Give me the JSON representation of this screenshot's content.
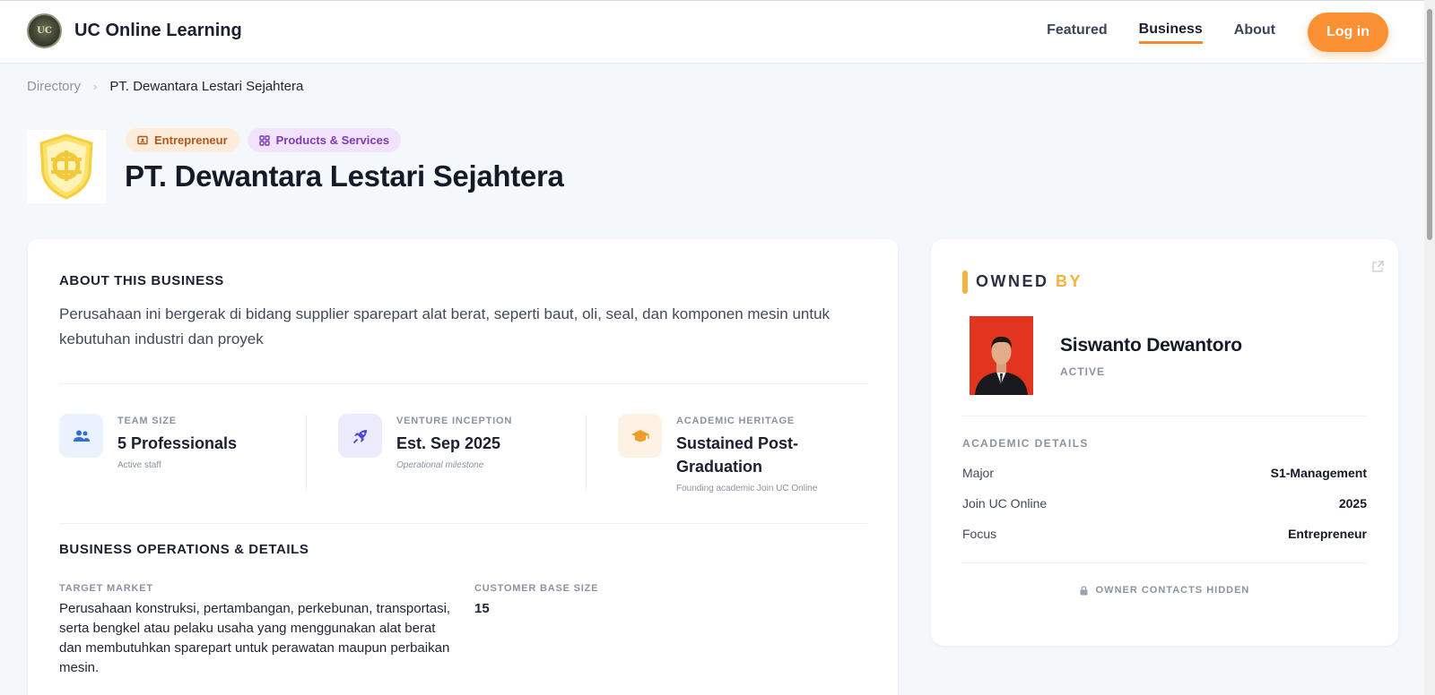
{
  "header": {
    "brand": "UC Online Learning",
    "logo_text": "UC",
    "nav": {
      "featured": "Featured",
      "business": "Business",
      "about": "About"
    },
    "login": "Log in"
  },
  "breadcrumb": {
    "directory": "Directory",
    "separator": "›",
    "current": "PT. Dewantara Lestari Sejahtera"
  },
  "business": {
    "tags": {
      "entrepreneur": "Entrepreneur",
      "products": "Products & Services"
    },
    "title": "PT. Dewantara Lestari Sejahtera"
  },
  "about": {
    "title": "ABOUT THIS BUSINESS",
    "text": "Perusahaan ini bergerak di bidang supplier sparepart alat berat, seperti baut, oli, seal, dan komponen mesin untuk kebutuhan industri dan proyek"
  },
  "stats": {
    "team": {
      "label": "TEAM SIZE",
      "value": "5 Professionals",
      "sub": "Active staff"
    },
    "venture": {
      "label": "VENTURE INCEPTION",
      "value": "Est. Sep 2025",
      "sub": "Operational milestone"
    },
    "academic": {
      "label": "ACADEMIC HERITAGE",
      "value_line1": "Sustained Post-",
      "value_line2": "Graduation",
      "sub": "Founding academic Join UC Online"
    }
  },
  "operations": {
    "title": "BUSINESS OPERATIONS & DETAILS",
    "target_label": "TARGET MARKET",
    "target_value": "Perusahaan konstruksi, pertambangan, perkebunan, transportasi, serta bengkel atau pelaku usaha yang menggunakan alat berat dan membutuhkan sparepart untuk perawatan maupun perbaikan mesin.",
    "customer_label": "CUSTOMER BASE SIZE",
    "customer_value": "15"
  },
  "owner": {
    "title_main": "OWNED",
    "title_accent": "BY",
    "name": "Siswanto Dewantoro",
    "status": "ACTIVE",
    "academic_title": "ACADEMIC DETAILS",
    "rows": [
      {
        "key": "Major",
        "value": "S1-Management"
      },
      {
        "key": "Join UC Online",
        "value": "2025"
      },
      {
        "key": "Focus",
        "value": "Entrepreneur"
      }
    ],
    "contacts_note": "OWNER CONTACTS HIDDEN"
  },
  "colors": {
    "accent": "#fb8f34",
    "gold": "#f6b23a",
    "background": "#f5f8fb"
  },
  "icons": [
    "users-icon",
    "rocket-icon",
    "graduation-cap-icon",
    "lock-icon",
    "external-link-icon",
    "chevron-right-icon"
  ]
}
